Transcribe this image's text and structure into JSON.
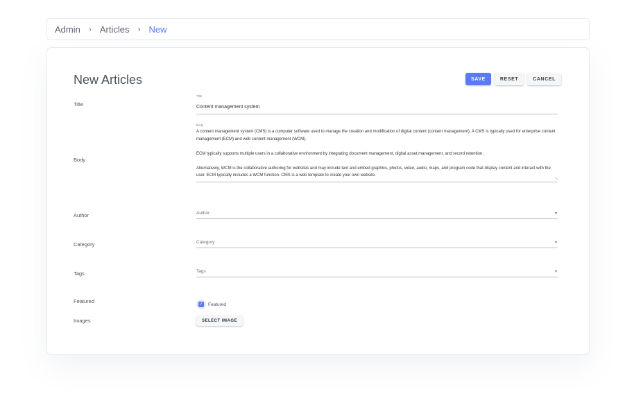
{
  "breadcrumb": {
    "items": [
      "Admin",
      "Articles"
    ],
    "current": "New",
    "separator": ">"
  },
  "page": {
    "title": "New Articles"
  },
  "actions": {
    "save": "SAVE",
    "reset": "RESET",
    "cancel": "CANCEL"
  },
  "form": {
    "title": {
      "row_label": "Title",
      "field_label": "Title",
      "value": "Content management system"
    },
    "body": {
      "row_label": "Body",
      "field_label": "Body",
      "paragraphs": [
        "A content management system (CMS) is a computer software used to manage the creation and modification of digital content (content management). A CMS is typically used for enterprise content management (ECM) and web content management (WCM).",
        "ECM typically supports multiple users in a collaborative environment by integrating document management, digital asset management, and record retention.",
        "Alternatively, WCM is the collaborative authoring for websites and may include text and embed graphics, photos, video, audio, maps, and program code that display content and interact with the user. ECM typically includes a WCM function. CMS is a web template to create your own website."
      ]
    },
    "author": {
      "row_label": "Author",
      "placeholder": "Author"
    },
    "category": {
      "row_label": "Category",
      "placeholder": "Category"
    },
    "tags": {
      "row_label": "Tags",
      "placeholder": "Tags"
    },
    "featured": {
      "row_label": "Featured",
      "checkbox_label": "Featured",
      "checked": true
    },
    "images": {
      "row_label": "Images",
      "button": "SELECT IMAGE"
    }
  },
  "colors": {
    "accent": "#5b7bf6",
    "text": "#3a3f44"
  }
}
